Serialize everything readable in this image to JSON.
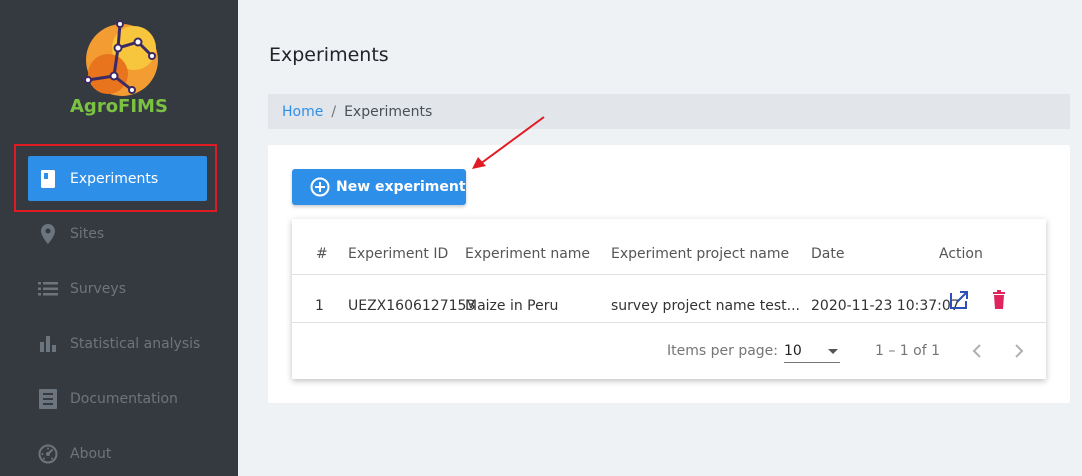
{
  "app": {
    "logo_text": "AgroFIMS"
  },
  "sidebar": {
    "items": [
      {
        "label": "Experiments",
        "icon": "book-icon",
        "active": true
      },
      {
        "label": "Sites",
        "icon": "map-pin-icon"
      },
      {
        "label": "Surveys",
        "icon": "list-icon"
      },
      {
        "label": "Statistical analysis",
        "icon": "bar-chart-icon"
      },
      {
        "label": "Documentation",
        "icon": "document-icon"
      },
      {
        "label": "About",
        "icon": "gauge-icon"
      }
    ]
  },
  "main": {
    "title": "Experiments",
    "breadcrumb": {
      "home": "Home",
      "separator": "/",
      "current": "Experiments"
    },
    "new_button_label": "New experiment",
    "table": {
      "headers": [
        "#",
        "Experiment ID",
        "Experiment name",
        "Experiment project name",
        "Date",
        "Action"
      ],
      "rows": [
        {
          "index": "1",
          "id": "UEZX1606127153",
          "name": "Maize in Peru",
          "project": "survey project name test...",
          "date": "2020-11-23 10:37:07"
        }
      ]
    },
    "paginator": {
      "items_per_page_label": "Items per page:",
      "items_per_page_value": "10",
      "range": "1 – 1 of 1"
    }
  },
  "colors": {
    "accent": "#2e8fe8",
    "sidebar_bg": "#343a40",
    "delete": "#e0245e",
    "annotation": "#e01b24"
  }
}
